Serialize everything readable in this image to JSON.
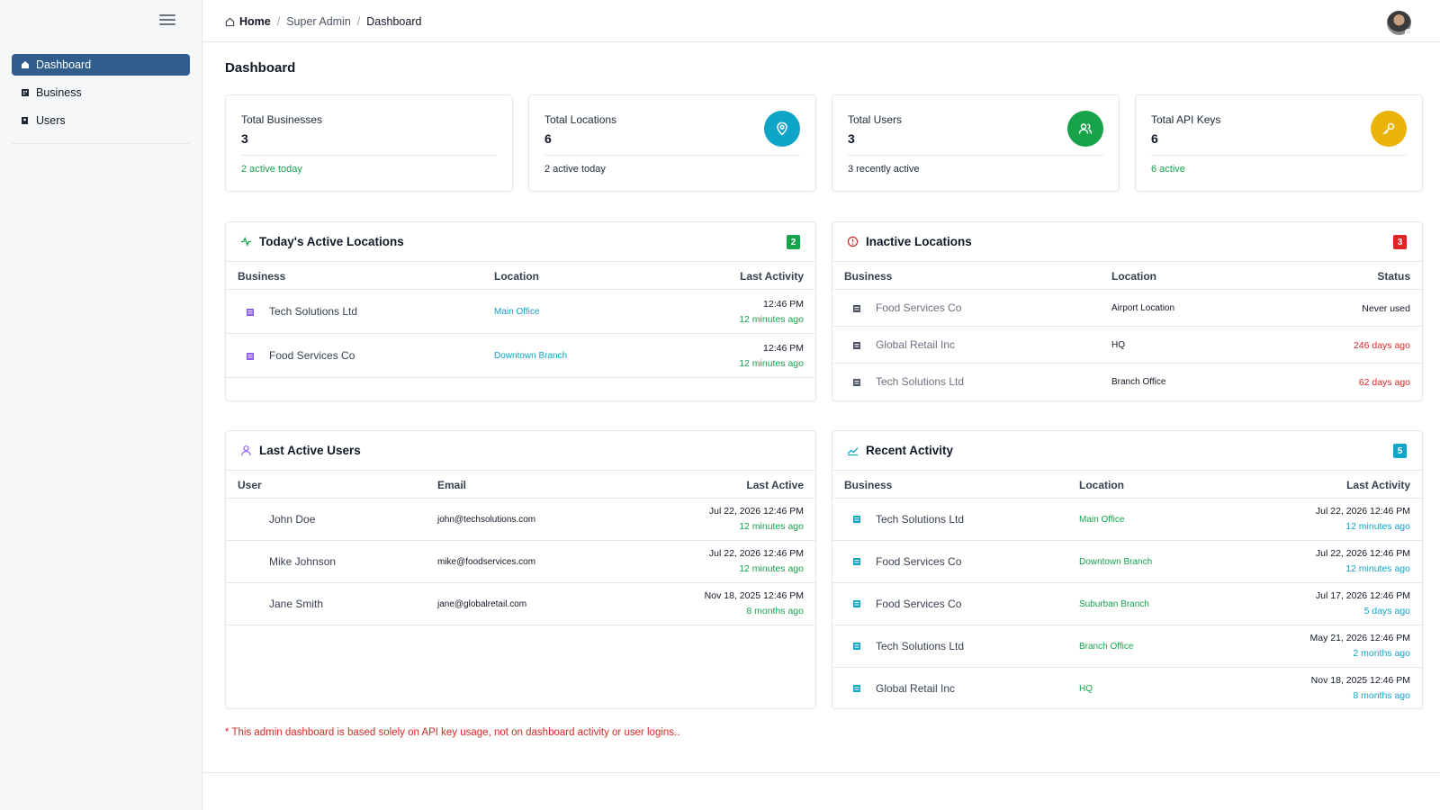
{
  "sidebar": {
    "items": [
      {
        "label": "Dashboard",
        "icon": "home-icon",
        "active": true
      },
      {
        "label": "Business",
        "icon": "building-icon",
        "active": false
      },
      {
        "label": "Users",
        "icon": "users-icon",
        "active": false
      }
    ]
  },
  "breadcrumb": {
    "home": "Home",
    "section": "Super Admin",
    "current": "Dashboard",
    "separator": "/"
  },
  "page_title": "Dashboard",
  "stats": [
    {
      "label": "Total Businesses",
      "value": "3",
      "foot": "2 active today",
      "foot_color": "#16a34a"
    },
    {
      "label": "Total Locations",
      "value": "6",
      "foot": "2 active today",
      "foot_color": "#1f2937",
      "icon": "location-pin-icon",
      "icon_color": "#0ea5c9"
    },
    {
      "label": "Total Users",
      "value": "3",
      "foot": "3 recently active",
      "foot_color": "#1f2937",
      "icon": "users-icon",
      "icon_color": "#16a34a"
    },
    {
      "label": "Total API Keys",
      "value": "6",
      "foot": "6 active",
      "foot_color": "#16a34a",
      "icon": "key-icon",
      "icon_color": "#eab308"
    }
  ],
  "active_locations": {
    "title": "Today's Active Locations",
    "count": "2",
    "headers": {
      "business": "Business",
      "location": "Location",
      "last": "Last Activity"
    },
    "rows": [
      {
        "business": "Tech Solutions Ltd",
        "location": "Main Office",
        "time": "12:46 PM",
        "ago": "12 minutes ago"
      },
      {
        "business": "Food Services Co",
        "location": "Downtown Branch",
        "time": "12:46 PM",
        "ago": "12 minutes ago"
      }
    ]
  },
  "inactive_locations": {
    "title": "Inactive Locations",
    "count": "3",
    "headers": {
      "business": "Business",
      "location": "Location",
      "status": "Status"
    },
    "rows": [
      {
        "business": "Food Services Co",
        "location": "Airport Location",
        "status": "Never used",
        "status_color": "#111827"
      },
      {
        "business": "Global Retail Inc",
        "location": "HQ",
        "status": "246 days ago",
        "status_color": "#dc2626"
      },
      {
        "business": "Tech Solutions Ltd",
        "location": "Branch Office",
        "status": "62 days ago",
        "status_color": "#dc2626"
      }
    ]
  },
  "last_users": {
    "title": "Last Active Users",
    "headers": {
      "user": "User",
      "email": "Email",
      "last": "Last Active"
    },
    "rows": [
      {
        "user": "John Doe",
        "email": "john@techsolutions.com",
        "time": "Jul 22, 2026 12:46 PM",
        "ago": "12 minutes ago"
      },
      {
        "user": "Mike Johnson",
        "email": "mike@foodservices.com",
        "time": "Jul 22, 2026 12:46 PM",
        "ago": "12 minutes ago"
      },
      {
        "user": "Jane Smith",
        "email": "jane@globalretail.com",
        "time": "Nov 18, 2025 12:46 PM",
        "ago": "8 months ago"
      }
    ]
  },
  "recent_activity": {
    "title": "Recent Activity",
    "count": "5",
    "headers": {
      "business": "Business",
      "location": "Location",
      "last": "Last Activity"
    },
    "rows": [
      {
        "business": "Tech Solutions Ltd",
        "location": "Main Office",
        "time": "Jul 22, 2026 12:46 PM",
        "ago": "12 minutes ago"
      },
      {
        "business": "Food Services Co",
        "location": "Downtown Branch",
        "time": "Jul 22, 2026 12:46 PM",
        "ago": "12 minutes ago"
      },
      {
        "business": "Food Services Co",
        "location": "Suburban Branch",
        "time": "Jul 17, 2026 12:46 PM",
        "ago": "5 days ago"
      },
      {
        "business": "Tech Solutions Ltd",
        "location": "Branch Office",
        "time": "May 21, 2026 12:46 PM",
        "ago": "2 months ago"
      },
      {
        "business": "Global Retail Inc",
        "location": "HQ",
        "time": "Nov 18, 2025 12:46 PM",
        "ago": "8 months ago"
      }
    ]
  },
  "footnote": "* This admin dashboard is based solely on API key usage, not on dashboard activity or user logins..",
  "colors": {
    "accent": "#2f5d8c",
    "green": "#16a34a",
    "teal": "#0ea5c9",
    "red": "#dc2626",
    "yellow": "#eab308",
    "purple": "#8b5cf6"
  }
}
